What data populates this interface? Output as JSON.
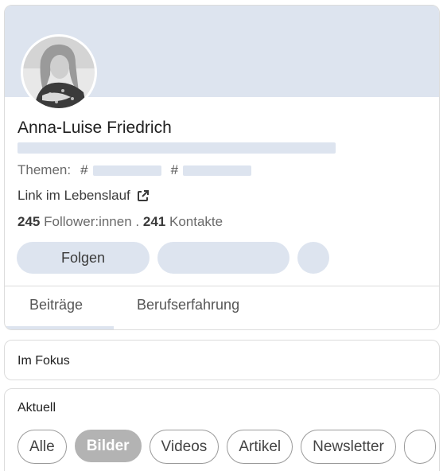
{
  "profile": {
    "name": "Anna-Luise Friedrich",
    "topics_label": "Themen:",
    "topic_hash": "#",
    "link_label": "Link im Lebenslauf",
    "followers_count": "245",
    "followers_label": "Follower:innen",
    "separator": ".",
    "contacts_count": "241",
    "contacts_label": "Kontakte",
    "follow_button": "Folgen"
  },
  "tabs": [
    {
      "label": "Beiträge",
      "active": true
    },
    {
      "label": "Berufserfahrung",
      "active": false
    }
  ],
  "focus": {
    "title": "Im Fokus"
  },
  "current": {
    "title": "Aktuell",
    "filters": [
      {
        "label": "Alle",
        "selected": false
      },
      {
        "label": "Bilder",
        "selected": true
      },
      {
        "label": "Videos",
        "selected": false
      },
      {
        "label": "Artikel",
        "selected": false
      },
      {
        "label": "Newsletter",
        "selected": false
      }
    ]
  },
  "icons": {
    "external_link": "external-link-icon",
    "avatar": "profile-photo"
  },
  "colors": {
    "skeleton": "#dde4ef",
    "selected_chip": "#b3b3b3"
  }
}
